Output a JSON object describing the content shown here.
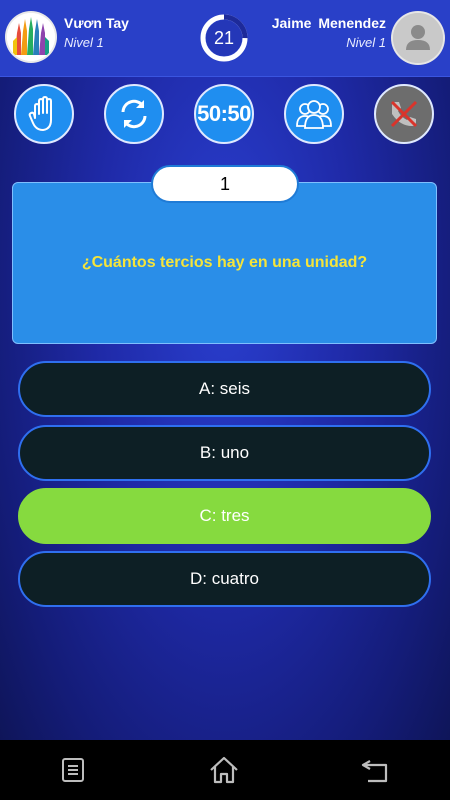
{
  "player_left": {
    "name": "Vươn Tay",
    "level": "Nivel 1"
  },
  "player_right": {
    "name": "Jaime Menendez",
    "level": "Nivel 1"
  },
  "timer": {
    "seconds": "21",
    "progress": 0.25
  },
  "lifelines": {
    "fifty_label": "50:50",
    "icons": [
      "hand-icon",
      "swap-icon",
      "fifty-fifty",
      "audience-icon",
      "call-disabled-icon"
    ]
  },
  "question": {
    "number": "1",
    "text": "¿Cuántos tercios hay en una unidad?"
  },
  "answers": [
    {
      "label": "A: seis"
    },
    {
      "label": "B: uno"
    },
    {
      "label": "C: tres"
    },
    {
      "label": "D: cuatro"
    }
  ],
  "colors": {
    "header": "#2940c8",
    "question_box": "#2a8ee8",
    "question_text": "#f5e43a",
    "answer_bg": "#0d1f25",
    "answer_border": "#2f6ff0",
    "correct": "#86da3f"
  },
  "navbar": [
    "menu-icon",
    "home-icon",
    "back-icon"
  ]
}
